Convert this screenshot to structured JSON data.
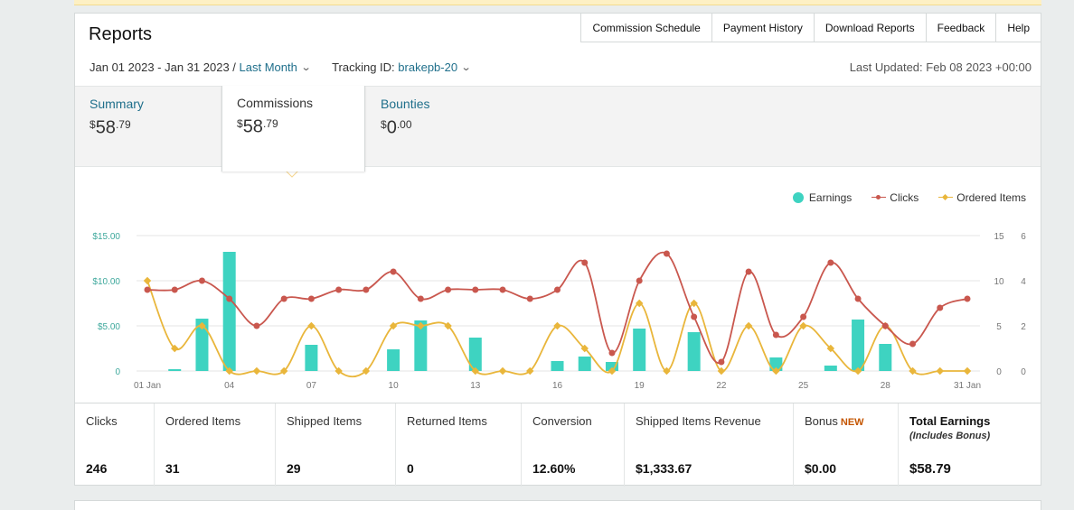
{
  "header": {
    "title": "Reports",
    "nav": [
      "Commission Schedule",
      "Payment History",
      "Download Reports",
      "Feedback",
      "Help"
    ]
  },
  "filters": {
    "date_range": "Jan 01 2023 - Jan 31 2023 /",
    "period": "Last Month",
    "tracking_label": "Tracking ID:",
    "tracking_id": "brakepb-20",
    "last_updated": "Last Updated: Feb 08 2023 +00:00"
  },
  "tabs": [
    {
      "label": "Summary",
      "currency": "$",
      "whole": "58",
      "cents": ".79"
    },
    {
      "label": "Commissions",
      "currency": "$",
      "whole": "58",
      "cents": ".79"
    },
    {
      "label": "Bounties",
      "currency": "$",
      "whole": "0",
      "cents": ".00"
    }
  ],
  "legend": {
    "earnings": "Earnings",
    "clicks": "Clicks",
    "items": "Ordered Items"
  },
  "colors": {
    "earnings": "#3ed3c1",
    "clicks": "#c9574e",
    "items": "#e9b63b",
    "link": "#1f6f8b"
  },
  "chart_data": {
    "type": "bar+line",
    "x": [
      "01 Jan",
      "02 Jan",
      "03 Jan",
      "04 Jan",
      "05 Jan",
      "06 Jan",
      "07 Jan",
      "08 Jan",
      "09 Jan",
      "10 Jan",
      "11 Jan",
      "12 Jan",
      "13 Jan",
      "14 Jan",
      "15 Jan",
      "16 Jan",
      "17 Jan",
      "18 Jan",
      "19 Jan",
      "20 Jan",
      "21 Jan",
      "22 Jan",
      "23 Jan",
      "24 Jan",
      "25 Jan",
      "26 Jan",
      "27 Jan",
      "28 Jan",
      "29 Jan",
      "30 Jan",
      "31 Jan"
    ],
    "x_tick_labels": [
      "01 Jan",
      "04",
      "07",
      "10",
      "13",
      "16",
      "19",
      "22",
      "25",
      "28",
      "31 Jan"
    ],
    "y_left_ticks": [
      "$15.00",
      "$10.00",
      "$5.00",
      "0"
    ],
    "y_clicks_ticks": [
      "15",
      "10",
      "5",
      "0"
    ],
    "y_items_ticks": [
      "6",
      "4",
      "2",
      "0"
    ],
    "ylim_earnings": [
      0,
      15
    ],
    "ylim_clicks": [
      0,
      15
    ],
    "ylim_items": [
      0,
      6
    ],
    "series": [
      {
        "name": "Earnings",
        "kind": "bar",
        "values": [
          0,
          0.2,
          5.8,
          13.2,
          0,
          0,
          2.9,
          0,
          0,
          2.4,
          5.6,
          0,
          3.7,
          0,
          0,
          1.1,
          1.6,
          1.0,
          4.7,
          0,
          4.3,
          0,
          0,
          1.5,
          0,
          0.6,
          5.7,
          3.0,
          0,
          0,
          0
        ]
      },
      {
        "name": "Clicks",
        "kind": "line",
        "values": [
          9,
          9,
          10,
          8,
          5,
          8,
          8,
          9,
          9,
          11,
          8,
          9,
          9,
          9,
          8,
          9,
          12,
          2,
          10,
          13,
          6,
          1,
          11,
          4,
          6,
          12,
          8,
          5,
          3,
          7,
          8
        ]
      },
      {
        "name": "Ordered Items",
        "kind": "line",
        "values": [
          4,
          1,
          2,
          0,
          0,
          0,
          2,
          0,
          0,
          2,
          2,
          2,
          0,
          0,
          0,
          2,
          1,
          0,
          3,
          0,
          3,
          0,
          2,
          0,
          2,
          1,
          0,
          2,
          0,
          0,
          0
        ]
      }
    ],
    "grid": true,
    "legend_position": "top-right"
  },
  "stats": [
    {
      "label": "Clicks",
      "value": "246"
    },
    {
      "label": "Ordered Items",
      "value": "31"
    },
    {
      "label": "Shipped Items",
      "value": "29"
    },
    {
      "label": "Returned Items",
      "value": "0"
    },
    {
      "label": "Conversion",
      "value": "12.60%"
    },
    {
      "label": "Shipped Items Revenue",
      "value": "$1,333.67"
    },
    {
      "label": "Bonus",
      "badge": "NEW",
      "value": "$0.00"
    },
    {
      "label": "Total Earnings",
      "sublabel": "(Includes Bonus)",
      "value": "$58.79"
    }
  ]
}
